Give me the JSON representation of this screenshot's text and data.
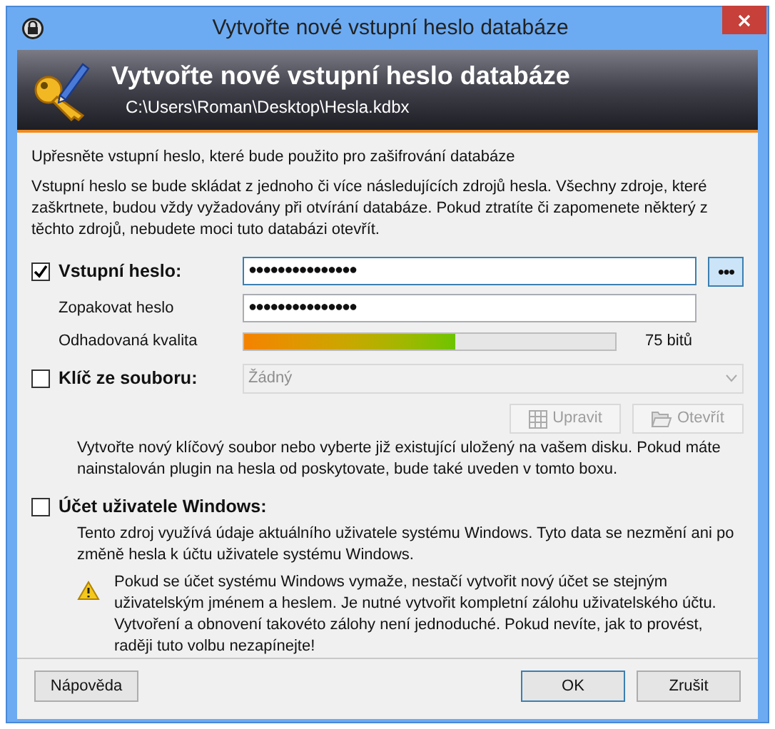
{
  "window": {
    "title": "Vytvořte nové vstupní heslo databáze"
  },
  "header": {
    "title": "Vytvořte nové vstupní heslo databáze",
    "path": "C:\\Users\\Roman\\Desktop\\Hesla.kdbx"
  },
  "intro": "Upřesněte vstupní heslo, které bude použito pro zašifrování databáze",
  "description": "Vstupní heslo se bude skládat z jednoho či více následujících zdrojů hesla. Všechny zdroje, které zaškrtnete, budou vždy vyžadovány při otvírání databáze. Pokud ztratíte či zapomenete některý z těchto zdrojů, nebudete moci tuto databázi otevřít.",
  "password": {
    "checked": true,
    "label": "Vstupní heslo:",
    "value": "●●●●●●●●●●●●●●●",
    "reveal_button": {
      "label": "●●●",
      "on": true
    }
  },
  "repeat": {
    "label": "Zopakovat heslo",
    "value": "●●●●●●●●●●●●●●●"
  },
  "quality": {
    "label": "Odhadovaná kvalita",
    "level": 0.57,
    "reading": "75 bitů"
  },
  "key_file": {
    "checked": false,
    "label": "Klíč ze souboru:",
    "dropdown": {
      "value": "Žádný",
      "disabled": true
    },
    "buttons": [
      {
        "kind": "edit",
        "label": "Upravit",
        "disabled": true
      },
      {
        "kind": "open",
        "label": "Otevřít",
        "disabled": true
      }
    ],
    "description": "Vytvořte nový klíčový soubor nebo vyberte již existující uložený na vašem disku. Pokud máte nainstalován plugin na hesla od poskytovate, bude také uveden v tomto boxu."
  },
  "windows_account": {
    "checked": false,
    "label": "Účet uživatele Windows:",
    "description": "Tento zdroj využívá údaje aktuálního uživatele systému Windows. Tyto data se nezmění ani po změně hesla k účtu uživatele systému Windows.",
    "warning": "Pokud se účet systému Windows vymaže, nestačí vytvořit nový účet se stejným uživatelským jménem a heslem. Je nutné vytvořit kompletní zálohu uživatelského účtu. Vytvoření a obnovení takovéto zálohy není jednoduché. Pokud nevíte, jak to provést, raději tuto volbu nezapínejte!"
  },
  "footer": {
    "help": "Nápověda",
    "ok": "OK",
    "cancel": "Zrušit"
  }
}
